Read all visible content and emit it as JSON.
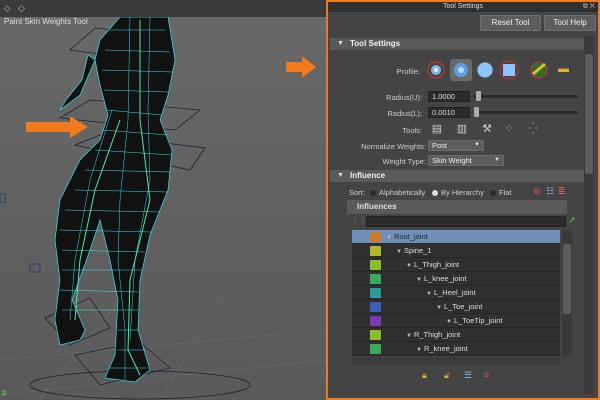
{
  "panel": {
    "title": "Tool Settings",
    "tool_name": "Paint Skin Weights Tool",
    "reset_label": "Reset Tool",
    "help_label": "Tool Help"
  },
  "tool_settings": {
    "header": "Tool Settings",
    "profile_label": "Profile:",
    "radius_u_label": "Radius(U):",
    "radius_u_value": "1.0000",
    "radius_u_level": 0.02,
    "radius_l_label": "Radius(L):",
    "radius_l_value": "0.0010",
    "radius_l_level": 0.0,
    "tools_label": "Tools:",
    "normalize_label": "Normalize Weights:",
    "normalize_value": "Post",
    "weight_type_label": "Weight Type:",
    "weight_type_value": "Skin Weight"
  },
  "influence": {
    "header": "Influence",
    "sort_label": "Sort:",
    "sort_options": [
      "Alphabetically",
      "By Hierarchy",
      "Flat"
    ],
    "sort_selected": "By Hierarchy",
    "list_header": "Influences",
    "joints": [
      {
        "name": "Root_joint",
        "color": "#c97a2a",
        "depth": 0,
        "selected": true
      },
      {
        "name": "Spine_1",
        "color": "#b5b52e",
        "depth": 1,
        "selected": false
      },
      {
        "name": "L_Thigh_joint",
        "color": "#8bbf2e",
        "depth": 2,
        "selected": false
      },
      {
        "name": "L_knee_joint",
        "color": "#3aa85e",
        "depth": 3,
        "selected": false
      },
      {
        "name": "L_Heel_joint",
        "color": "#2e9c9c",
        "depth": 4,
        "selected": false
      },
      {
        "name": "L_Toe_joint",
        "color": "#3a5fb5",
        "depth": 5,
        "selected": false
      },
      {
        "name": "L_ToeTip_joint",
        "color": "#7a3ab5",
        "depth": 6,
        "selected": false
      },
      {
        "name": "R_Thigh_joint",
        "color": "#8bbf2e",
        "depth": 2,
        "selected": false
      },
      {
        "name": "R_knee_joint",
        "color": "#3aa85e",
        "depth": 3,
        "selected": false
      }
    ]
  },
  "viewport": {
    "axis_label": "p"
  },
  "colors": {
    "highlight_orange": "#f07a1c",
    "selection_blue": "#6f90b8"
  }
}
